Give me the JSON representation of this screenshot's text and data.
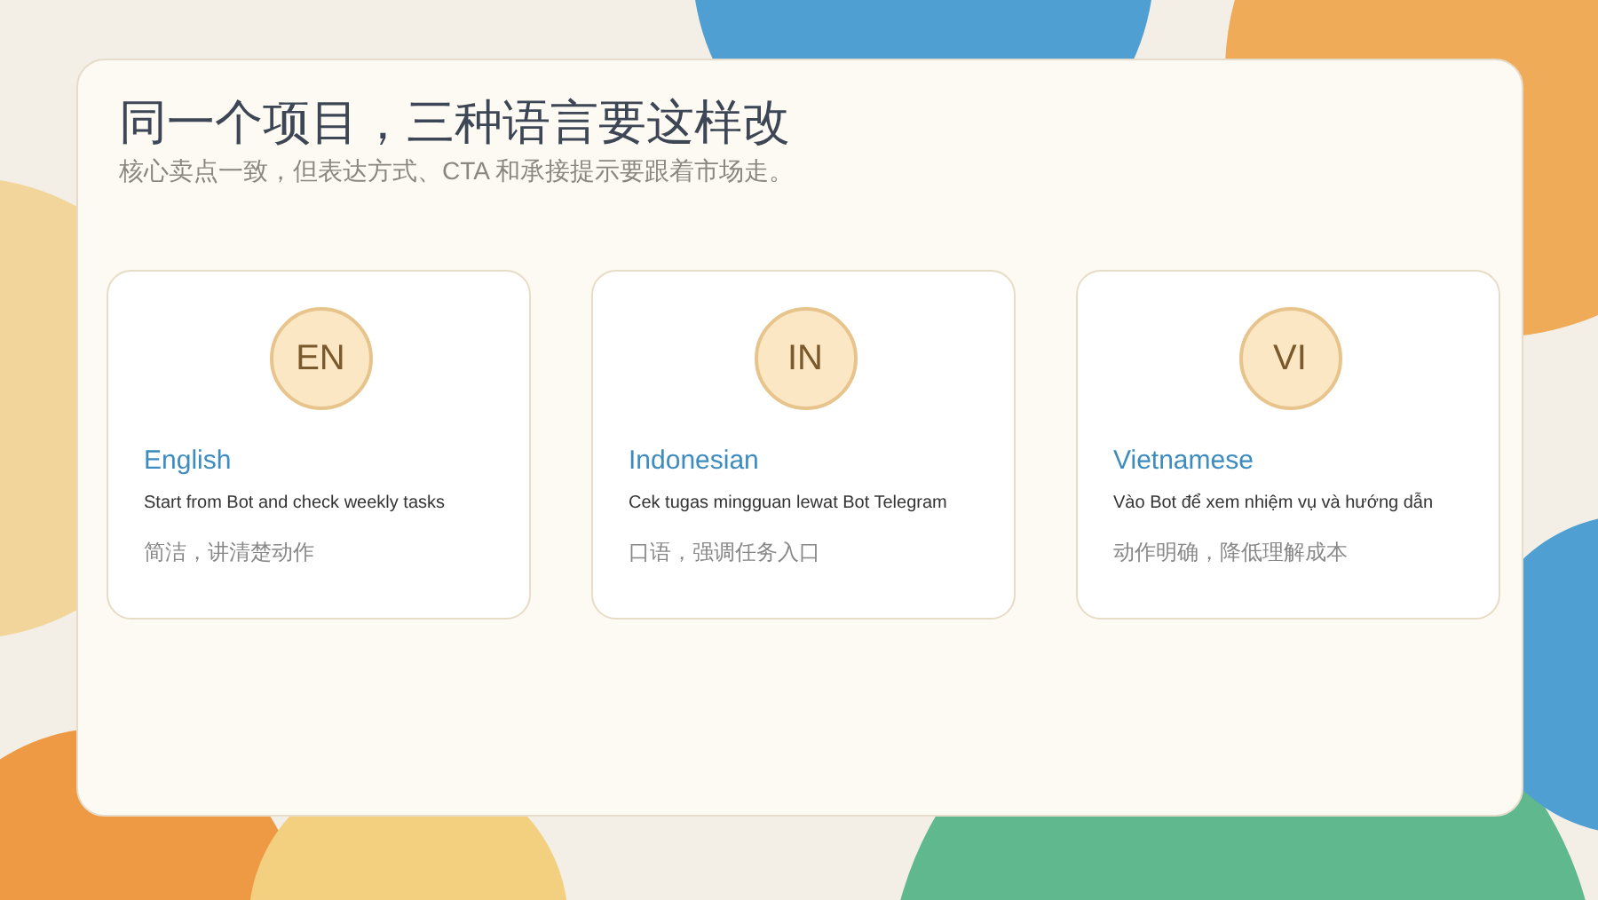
{
  "slide": {
    "title": "同一个项目，三种语言要这样改",
    "subtitle": "核心卖点一致，但表达方式、CTA 和承接提示要跟着市场走。",
    "cards": [
      {
        "code": "EN",
        "language": "English",
        "example": "Start from Bot and check weekly tasks",
        "note": "简洁，讲清楚动作"
      },
      {
        "code": "IN",
        "language": "Indonesian",
        "example": "Cek tugas mingguan lewat Bot Telegram",
        "note": "口语，强调任务入口"
      },
      {
        "code": "VI",
        "language": "Vietnamese",
        "example": "Vào Bot để xem nhiệm vụ và hướng dẫn",
        "note": "动作明确，降低理解成本"
      }
    ]
  }
}
